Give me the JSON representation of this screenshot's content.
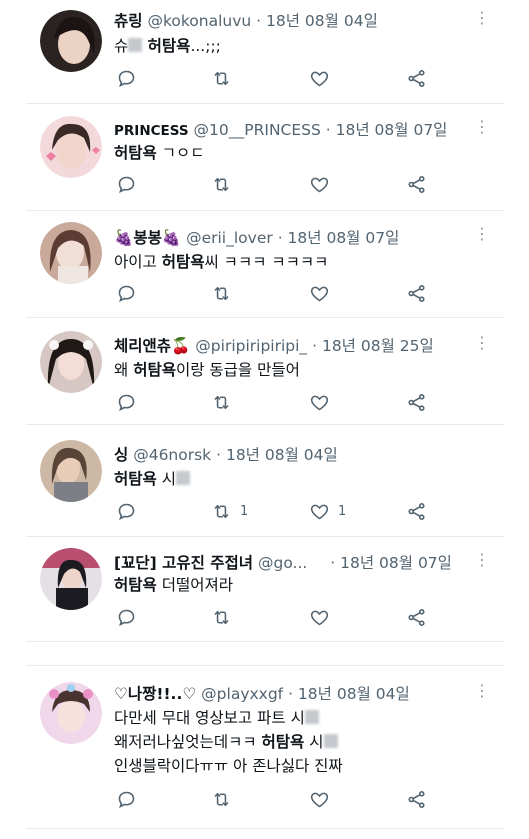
{
  "tweets": [
    {
      "name": "츄링",
      "handle": "@kokonaluvu",
      "date": "· 18년 08월 04일",
      "lines": [
        [
          {
            "t": "슈",
            "b": false
          },
          {
            "blur": true
          },
          {
            "t": " 허탐욕",
            "b": true
          },
          {
            "t": "...;;;",
            "b": false
          }
        ]
      ],
      "reply": "",
      "retweet": "",
      "like": "",
      "colors": [
        "#3b2f2f",
        "#e8d3c7"
      ]
    },
    {
      "name": "PRINCESS",
      "handle": "@10__PRINCESS",
      "date": "· 18년 08월 07일",
      "lines": [
        [
          {
            "t": "허탐욕",
            "b": true
          },
          {
            "t": " ㄱㅇㄷ",
            "b": false
          }
        ]
      ],
      "reply": "",
      "retweet": "",
      "like": "",
      "colors": [
        "#f4b7c5",
        "#e9d6d4"
      ]
    },
    {
      "name": "봉봉",
      "handle": "@erii_lover",
      "date": "· 18년 08월 07일",
      "lines": [
        [
          {
            "t": "아이고 ",
            "b": false
          },
          {
            "t": "허탐욕",
            "b": true
          },
          {
            "t": "씨 ㅋㅋㅋ ㅋㅋㅋㅋ",
            "b": false
          }
        ]
      ],
      "reply": "",
      "retweet": "",
      "like": "",
      "colors": [
        "#b59486",
        "#efe3dc"
      ]
    },
    {
      "name": "체리앤츄",
      "handle": "@piripiripiripi_",
      "date": "· 18년 08월 25일",
      "lines": [
        [
          {
            "t": "왜 ",
            "b": false
          },
          {
            "t": "허탐욕",
            "b": true
          },
          {
            "t": "이랑 동급을 만들어",
            "b": false
          }
        ]
      ],
      "reply": "",
      "retweet": "",
      "like": "",
      "colors": [
        "#2f2622",
        "#f0d7d0"
      ]
    },
    {
      "name": "싱",
      "handle": "@46norsk",
      "date": "· 18년 08월 04일",
      "lines": [
        [
          {
            "t": "허탐욕",
            "b": true
          },
          {
            "t": " 시",
            "b": false
          },
          {
            "blur": true
          }
        ]
      ],
      "reply": "",
      "retweet": "1",
      "like": "1",
      "colors": [
        "#7a5f4e",
        "#d8c3b2"
      ]
    },
    {
      "name": "[꾜단] 고유진 주접녀",
      "handle": "@go...",
      "date": "· 18년 08월 07일",
      "lines": [
        [
          {
            "t": "허탐욕",
            "b": true
          },
          {
            "t": " 더떨어져라",
            "b": false
          }
        ]
      ],
      "reply": "",
      "retweet": "",
      "like": "",
      "colors": [
        "#1e1e28",
        "#e7cfcf"
      ]
    },
    {
      "name": "♡나짱!!..♡",
      "handle": "@playxxgf",
      "date": "· 18년 08월 04일",
      "lines": [
        [
          {
            "t": "다만세 무대 영상보고 파트 시",
            "b": false
          },
          {
            "blur": true
          }
        ],
        [
          {
            "t": "왜저러나싶엇는데ㅋㅋ ",
            "b": false
          },
          {
            "t": "허탐욕",
            "b": true
          },
          {
            "t": " 시",
            "b": false
          },
          {
            "blur": true
          }
        ],
        [
          {
            "t": "인생블락이다ㅠㅠ 아 존나싫다 진짜",
            "b": false
          }
        ]
      ],
      "reply": "",
      "retweet": "",
      "like": "",
      "colors": [
        "#e6b3d6",
        "#f7e6ee"
      ]
    }
  ]
}
